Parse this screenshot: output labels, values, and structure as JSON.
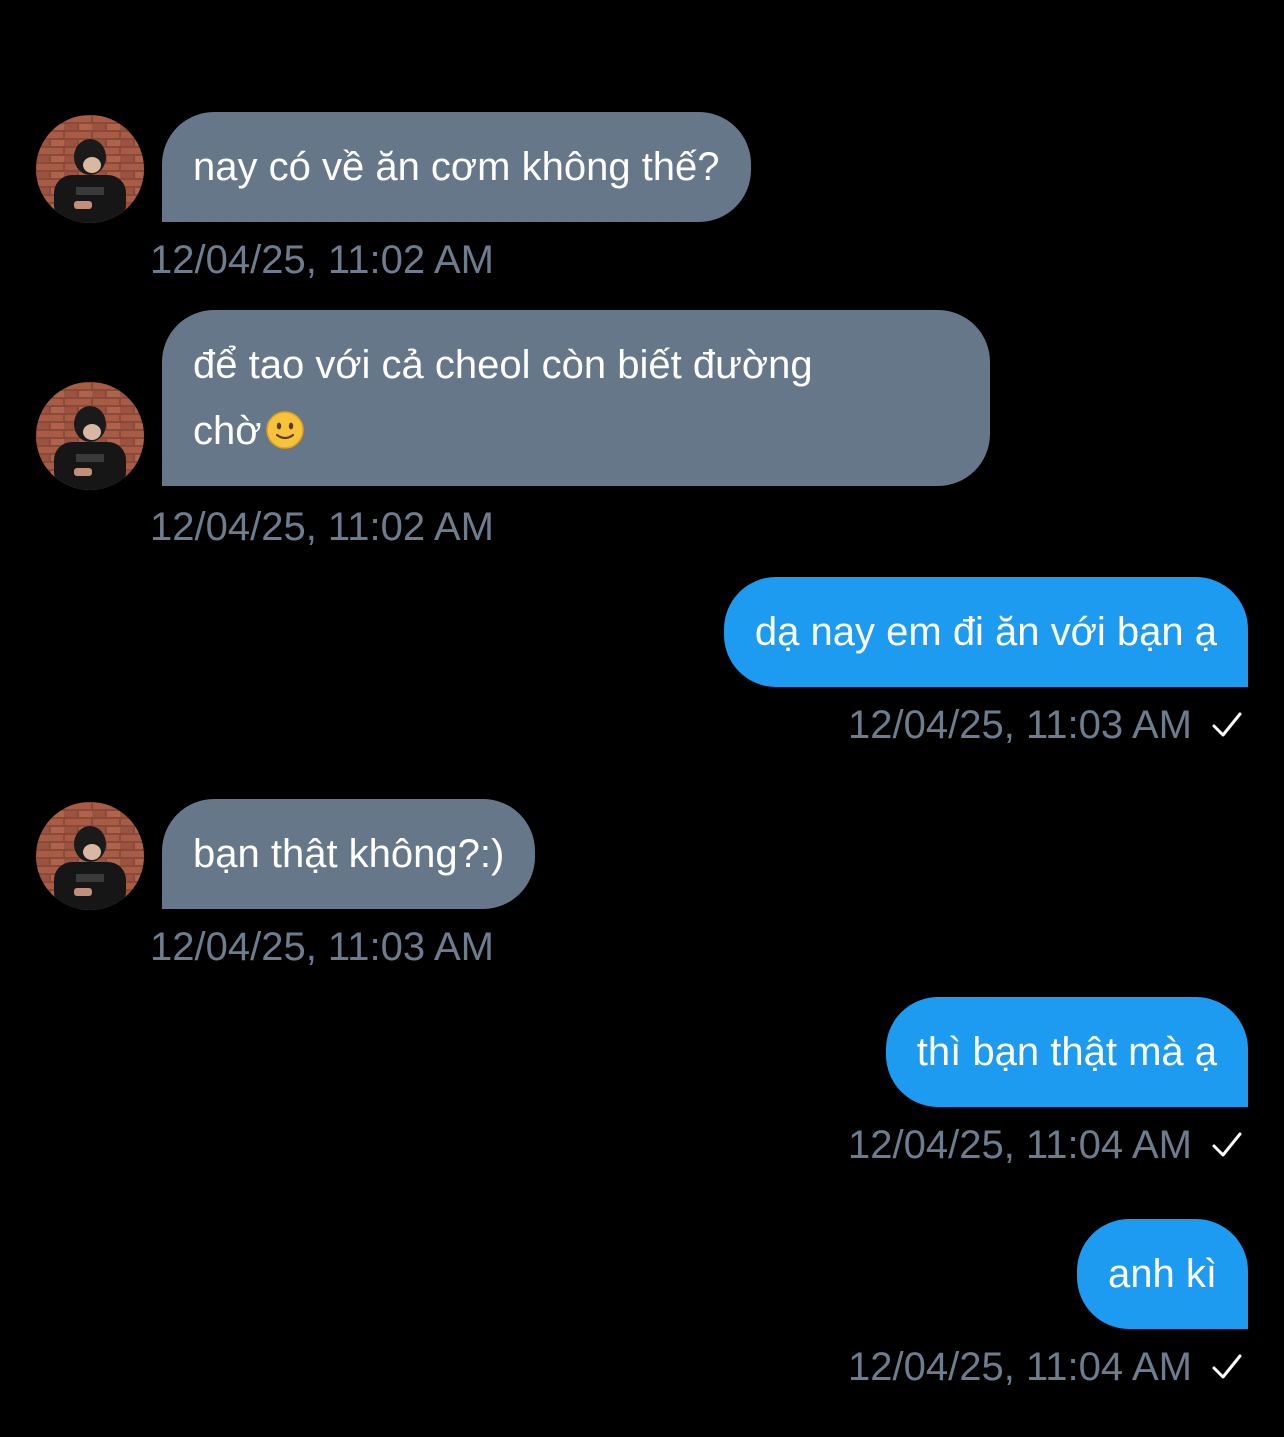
{
  "colors": {
    "background": "#000000",
    "incoming_bubble": "#66778a",
    "outgoing_bubble": "#1d9bf0",
    "timestamp": "#6e7d8d"
  },
  "messages": [
    {
      "direction": "incoming",
      "text": "nay có về ăn cơm không thế?",
      "time": "12/04/25, 11:02 AM",
      "avatar": "contact-avatar"
    },
    {
      "direction": "incoming",
      "text_line1": "để tao với cả cheol còn biết đường",
      "text_line2": "chờ",
      "emoji": "slightly-smiling-face-emoji",
      "time": "12/04/25, 11:02 AM",
      "avatar": "contact-avatar"
    },
    {
      "direction": "outgoing",
      "text": "dạ nay em đi ăn với bạn ạ",
      "time": "12/04/25, 11:03 AM",
      "status_icon": "checkmark-icon"
    },
    {
      "direction": "incoming",
      "text": "bạn thật không?:)",
      "time": "12/04/25, 11:03 AM",
      "avatar": "contact-avatar"
    },
    {
      "direction": "outgoing",
      "text": "thì bạn thật mà ạ",
      "time": "12/04/25, 11:04 AM",
      "status_icon": "checkmark-icon"
    },
    {
      "direction": "outgoing",
      "text": "anh kì",
      "time": "12/04/25, 11:04 AM",
      "status_icon": "checkmark-icon"
    }
  ]
}
